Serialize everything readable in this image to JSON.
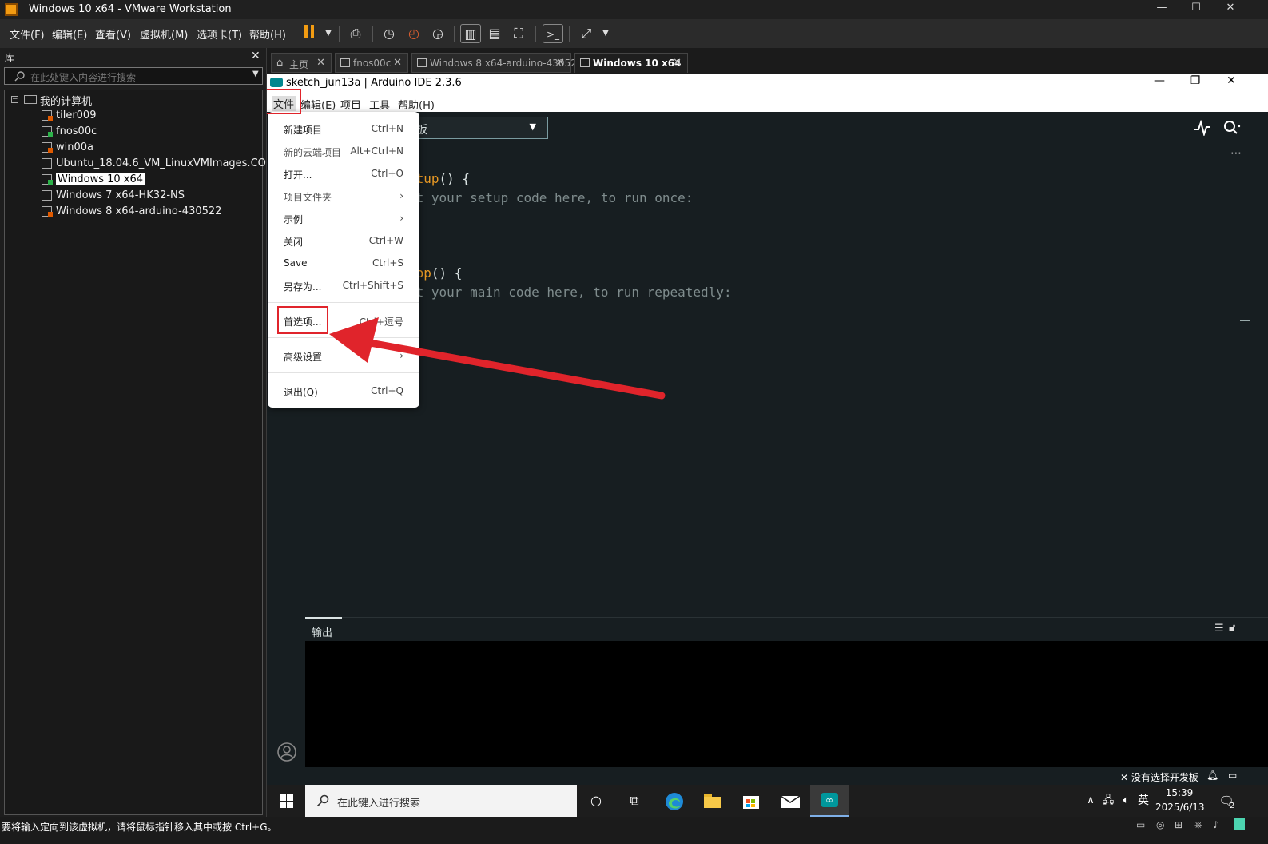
{
  "vm_window": {
    "title": "Windows 10 x64 - VMware Workstation",
    "controls": {
      "minimize": "—",
      "maximize": "☐",
      "close": "✕"
    }
  },
  "vm_menu": [
    "文件(F)",
    "编辑(E)",
    "查看(V)",
    "虚拟机(M)",
    "选项卡(T)",
    "帮助(H)"
  ],
  "library": {
    "header": "库",
    "close": "✕",
    "search_placeholder": "在此处键入内容进行搜索",
    "root": "我的计算机",
    "items": [
      {
        "label": "tiler009",
        "color": "#e05a00"
      },
      {
        "label": "fnos00c",
        "color": "#2db24a"
      },
      {
        "label": "win00a",
        "color": "#e05a00"
      },
      {
        "label": "Ubuntu_18.04.6_VM_LinuxVMImages.COM",
        "color": ""
      },
      {
        "label": "Windows 10 x64",
        "color": "#2db24a",
        "selected": true
      },
      {
        "label": "Windows 7 x64-HK32-NS",
        "color": ""
      },
      {
        "label": "Windows 8 x64-arduino-430522",
        "color": "#e05a00"
      }
    ]
  },
  "vm_tabs": [
    {
      "label": "主页"
    },
    {
      "label": "fnos00c"
    },
    {
      "label": "Windows 8 x64-arduino-430522"
    },
    {
      "label": "Windows 10 x64",
      "active": true
    }
  ],
  "ide": {
    "title": "sketch_jun13a | Arduino IDE 2.3.6",
    "menu": [
      "文件",
      "编辑(E)",
      "项目",
      "工具",
      "帮助(H)"
    ],
    "board_select": "板",
    "code": {
      "setup_kw": "etup",
      "setup_rest": "() {",
      "setup_comment": "ut your setup code here, to run once:",
      "loop_kw": "oop",
      "loop_rest": "() {",
      "loop_comment": "ut your main code here, to run repeatedly:"
    },
    "output_label": "输出",
    "status_text": "没有选择开发板"
  },
  "file_menu": [
    {
      "label": "新建项目",
      "shortcut": "Ctrl+N"
    },
    {
      "label": "新的云端项目",
      "shortcut": "Alt+Ctrl+N"
    },
    {
      "label": "打开...",
      "shortcut": "Ctrl+O"
    },
    {
      "label": "项目文件夹",
      "shortcut": "›"
    },
    {
      "label": "示例",
      "shortcut": "›"
    },
    {
      "label": "关闭",
      "shortcut": "Ctrl+W"
    },
    {
      "label": "Save",
      "shortcut": "Ctrl+S"
    },
    {
      "label": "另存为...",
      "shortcut": "Ctrl+Shift+S"
    },
    {
      "label": "首选项...",
      "shortcut": "Ctrl+逗号"
    },
    {
      "label": "高级设置",
      "shortcut": "›"
    },
    {
      "label": "退出(Q)",
      "shortcut": "Ctrl+Q"
    }
  ],
  "taskbar": {
    "search_placeholder": "在此键入进行搜索",
    "ime": "英",
    "time": "15:39",
    "date": "2025/6/13",
    "notification_count": "2"
  },
  "vm_status": "要将输入定向到该虚拟机，请将鼠标指针移入其中或按 Ctrl+G。",
  "colors": {
    "highlight": "#e0242b",
    "arduino_teal": "#00878f",
    "keyword": "#e89924"
  }
}
